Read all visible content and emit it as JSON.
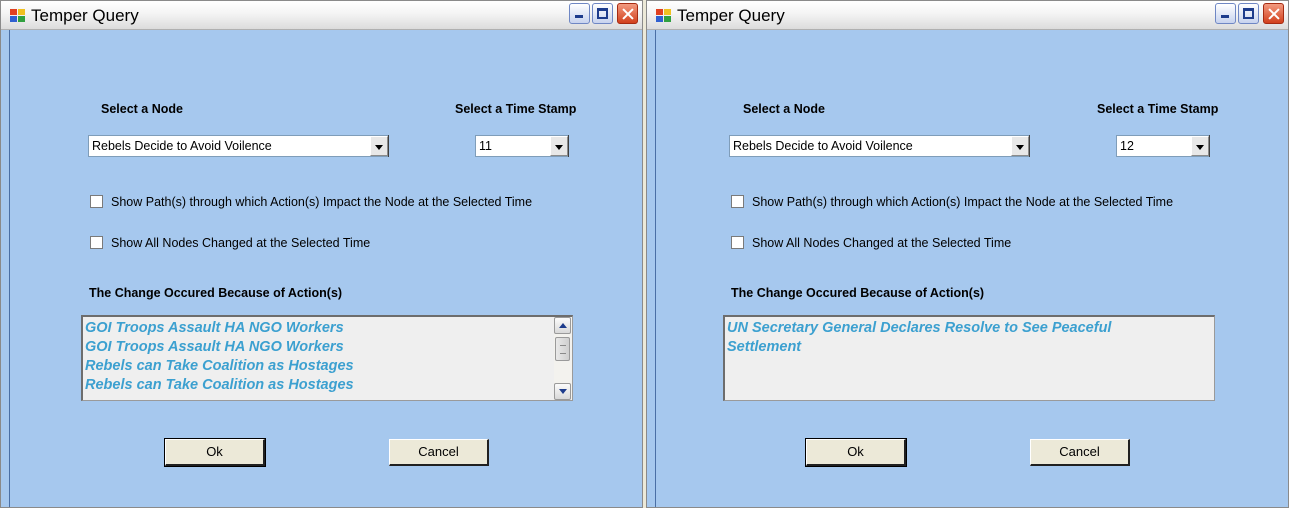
{
  "windows": [
    {
      "title": "Temper Query",
      "node_label": "Select a Node",
      "node_value": "Rebels Decide to Avoid Voilence",
      "timestamp_label": "Select a Time Stamp",
      "timestamp_value": "11",
      "show_paths_label": "Show Path(s) through which Action(s) Impact the Node at the Selected Time",
      "show_all_label": "Show All Nodes Changed at the Selected Time",
      "change_label": "The Change Occured Because of Action(s)",
      "actions": [
        "GOI Troops Assault HA NGO Workers",
        "GOI Troops Assault HA NGO Workers",
        "Rebels can Take Coalition as Hostages",
        "Rebels can Take Coalition as Hostages"
      ],
      "ok_label": "Ok",
      "cancel_label": "Cancel"
    },
    {
      "title": "Temper Query",
      "node_label": "Select a Node",
      "node_value": "Rebels Decide to Avoid Voilence",
      "timestamp_label": "Select a Time Stamp",
      "timestamp_value": "12",
      "show_paths_label": "Show Path(s) through which Action(s) Impact the Node at the Selected Time",
      "show_all_label": "Show All Nodes Changed at the Selected Time",
      "change_label": "The Change Occured Because of Action(s)",
      "actions": [
        "UN Secretary General Declares Resolve to See Peaceful",
        "Settlement"
      ],
      "ok_label": "Ok",
      "cancel_label": "Cancel"
    }
  ],
  "colors": {
    "client_bg": "#a6c8ee",
    "action_text": "#3ca0d0"
  }
}
